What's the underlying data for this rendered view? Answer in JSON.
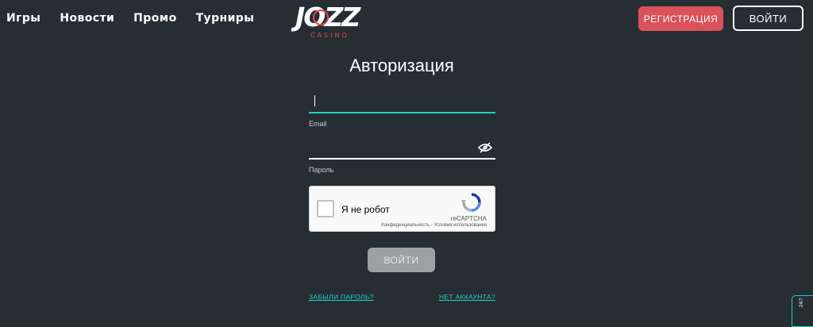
{
  "nav": {
    "items": [
      {
        "label": "Игры"
      },
      {
        "label": "Новости"
      },
      {
        "label": "Промо"
      },
      {
        "label": "Турниры"
      }
    ]
  },
  "logo": {
    "title": "JOZZ",
    "subtitle": "CASINO"
  },
  "header": {
    "register_label": "РЕГИСТРАЦИЯ",
    "login_label": "ВОЙТИ"
  },
  "form": {
    "title": "Авторизация",
    "email_label": "Email",
    "email_value": "",
    "password_label": "Пароль",
    "password_value": "",
    "submit_label": "ВОЙТИ",
    "forgot_label": "ЗАБЫЛИ ПАРОЛЬ?",
    "no_account_label": "НЕТ АККАУНТА?"
  },
  "captcha": {
    "checkbox_label": "Я не робот",
    "brand": "reCAPTCHA",
    "links": "Конфиденциальность - Условия использования"
  },
  "support": {
    "label": "24/7"
  },
  "colors": {
    "background": "#262e33",
    "accent": "#20d0bf",
    "register": "#d9525a",
    "disabled_button": "#9ea1a3"
  }
}
